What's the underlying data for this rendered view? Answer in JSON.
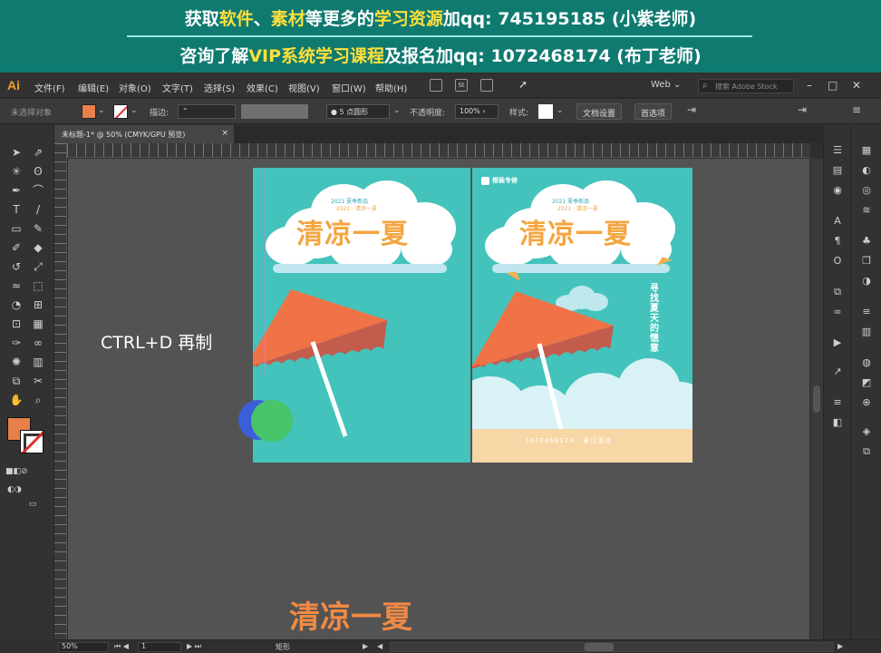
{
  "banner": {
    "line1": [
      {
        "text": "获取",
        "color": "white"
      },
      {
        "text": "软件",
        "color": "yellow"
      },
      {
        "text": "、",
        "color": "white"
      },
      {
        "text": "素材",
        "color": "yellow"
      },
      {
        "text": "等更多的",
        "color": "white"
      },
      {
        "text": "学习资源",
        "color": "yellow"
      },
      {
        "text": "加qq:  745195185 (小紫老师)",
        "color": "white"
      }
    ],
    "line2": [
      {
        "text": "咨询了解",
        "color": "white"
      },
      {
        "text": "VIP系统学习课程",
        "color": "yellow"
      },
      {
        "text": "及报名加qq:  1072468174 (布丁老师)",
        "color": "white"
      }
    ]
  },
  "app": {
    "logo": "Ai",
    "menus": [
      "文件(F)",
      "编辑(E)",
      "对象(O)",
      "文字(T)",
      "选择(S)",
      "效果(C)",
      "视图(V)",
      "窗口(W)",
      "帮助(H)"
    ],
    "workspace": "Web",
    "stock_search_placeholder": "搜索 Adobe Stock"
  },
  "control_bar": {
    "selection_label": "未选择对象",
    "stroke_label": "描边:",
    "brush_value": "5 点圆形",
    "opacity_label": "不透明度:",
    "opacity_value": "100%",
    "style_label": "样式:",
    "doc_setup": "文档设置",
    "preferences": "首选项"
  },
  "document": {
    "tab_title": "未标题-1* @ 50% (CMYK/GPU 预览)",
    "close_symbol": "×"
  },
  "canvas": {
    "overlay_text": "CTRL+D 再制",
    "bottom_title": "清凉一夏"
  },
  "artboard1": {
    "subtitle_top": "2021 夏季新品",
    "subtitle_bottom": "2021 · 清凉一夏",
    "title": "清凉一夏"
  },
  "artboard2": {
    "brand": "橙装专修",
    "subtitle_top": "2021 夏季新品",
    "subtitle_bottom": "2021 · 清凉一夏",
    "title": "清凉一夏",
    "vertical_text": "寻找夏天的惬意",
    "footer_text": "1072468174 · 夏日清凉"
  },
  "status_bar": {
    "zoom": "50%",
    "artboard_num": "1",
    "tool_name": "矩形"
  },
  "colors": {
    "banner_bg": "#0f7a70",
    "accent_yellow": "#ffe03a",
    "artboard_teal": "#43c3bc",
    "umbrella_orange": "#ef7346",
    "title_orange": "#f4a540",
    "fill_swatch": "#e8804a"
  },
  "icons": {
    "tools": [
      "selection-tool-icon",
      "direct-selection-tool-icon",
      "magic-wand-icon",
      "lasso-icon",
      "pen-tool-icon",
      "curvature-tool-icon",
      "type-tool-icon",
      "line-tool-icon",
      "rectangle-tool-icon",
      "paintbrush-icon",
      "shaper-tool-icon",
      "eraser-icon",
      "rotate-tool-icon",
      "scale-tool-icon",
      "width-tool-icon",
      "free-transform-icon",
      "shape-builder-icon",
      "perspective-grid-icon",
      "mesh-tool-icon",
      "gradient-tool-icon",
      "eyedropper-icon",
      "blend-tool-icon",
      "symbol-sprayer-icon",
      "column-graph-icon",
      "artboard-tool-icon",
      "slice-tool-icon",
      "hand-tool-icon",
      "zoom-tool-icon"
    ]
  }
}
